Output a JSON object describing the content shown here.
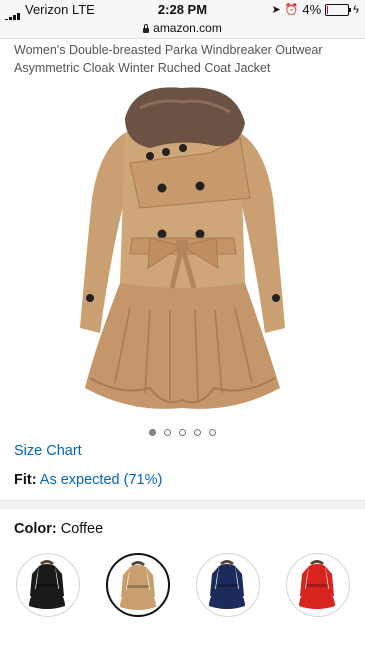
{
  "status_bar": {
    "carrier": "Verizon  LTE",
    "time": "2:28 PM",
    "battery": "4%",
    "battery_level": 0.04,
    "icons": [
      "signal-icon",
      "location-arrow-icon",
      "alarm-icon",
      "battery-icon",
      "charging-icon"
    ]
  },
  "browser": {
    "url": "amazon.com",
    "icons": [
      "lock-icon"
    ]
  },
  "product": {
    "title": "Women's Double-breasted Parka Windbreaker Outwear Asymmetric Cloak Winter Ruched Coat Jacket",
    "image_count": 5,
    "active_image": 0
  },
  "links": {
    "size_chart": "Size Chart",
    "fit_label": "Fit:",
    "fit_value": "As expected (71%)"
  },
  "color": {
    "label": "Color:",
    "selected": "Coffee",
    "swatches": [
      {
        "name": "Black",
        "hex": "#1a1a1a",
        "selected": false
      },
      {
        "name": "Coffee",
        "hex": "#c9a06d",
        "selected": true
      },
      {
        "name": "Navy",
        "hex": "#1d2a5c",
        "selected": false
      },
      {
        "name": "Red",
        "hex": "#d8231f",
        "selected": false
      }
    ]
  }
}
